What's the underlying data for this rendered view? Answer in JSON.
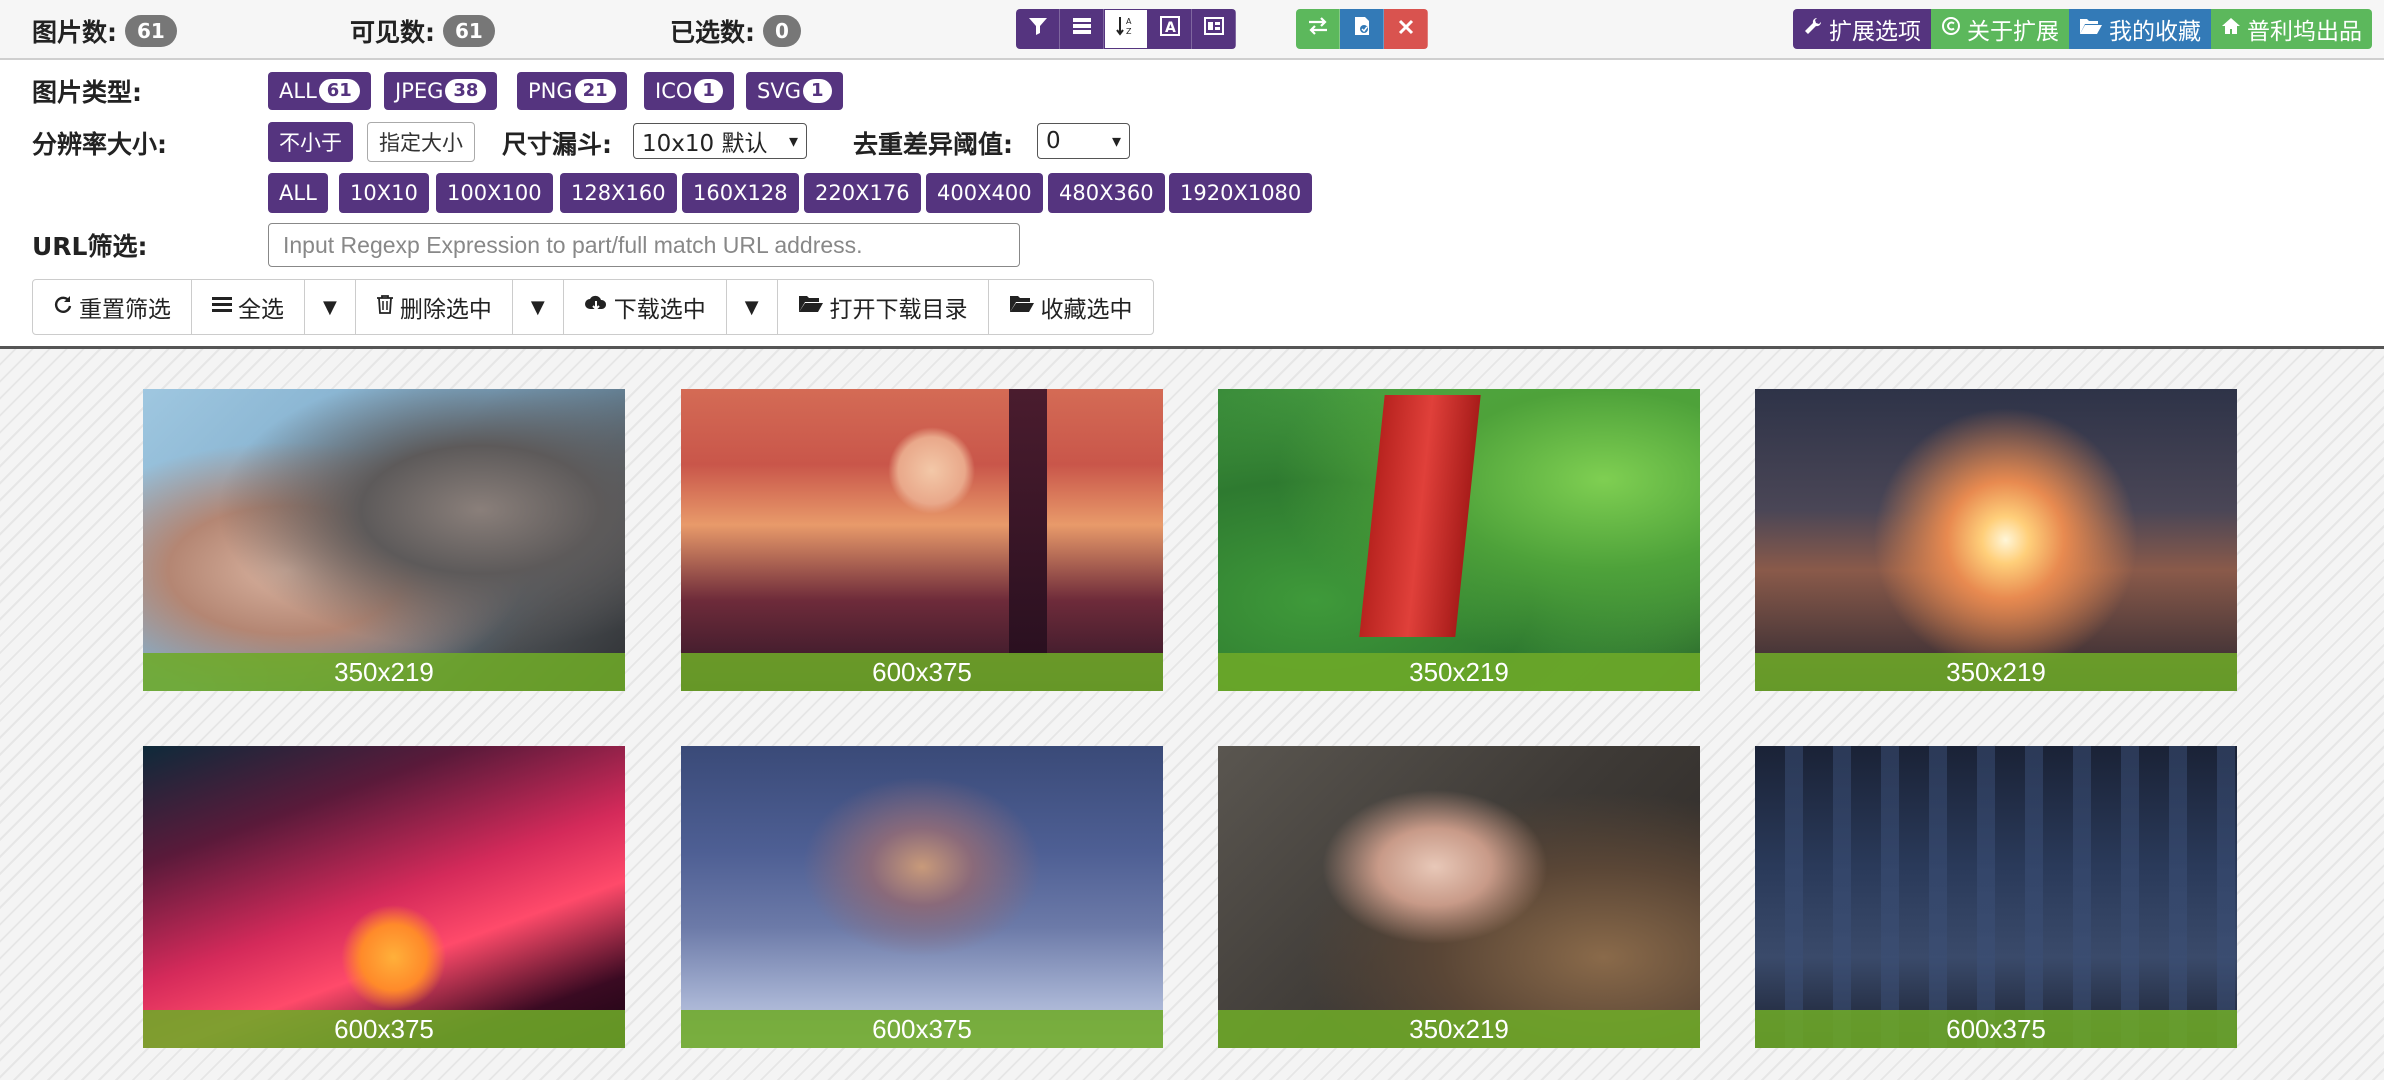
{
  "stats": {
    "total_label": "图片数:",
    "total": "61",
    "visible_label": "可见数:",
    "visible": "61",
    "selected_label": "已选数:",
    "selected": "0"
  },
  "toolbar_icons": [
    "filter-icon",
    "list-icon",
    "sort-icon",
    "font-icon",
    "layout-icon"
  ],
  "action_icons": [
    "swap-icon",
    "file-icon",
    "close-icon"
  ],
  "right_buttons": {
    "options": "扩展选项",
    "about": "关于扩展",
    "favorites": "我的收藏",
    "product": "普利坞出品"
  },
  "filters": {
    "type_label": "图片类型:",
    "types": [
      {
        "label": "ALL",
        "count": "61"
      },
      {
        "label": "JPEG",
        "count": "38"
      },
      {
        "label": "PNG",
        "count": "21"
      },
      {
        "label": "ICO",
        "count": "1"
      },
      {
        "label": "SVG",
        "count": "1"
      }
    ],
    "resolution_label": "分辨率大小:",
    "not_smaller": "不小于",
    "specify_size": "指定大小",
    "funnel_label": "尺寸漏斗:",
    "funnel_value": "10x10 默认",
    "dedupe_label": "去重差异阈值:",
    "dedupe_value": "0",
    "sizes": [
      "ALL",
      "10X10",
      "100X100",
      "128X160",
      "160X128",
      "220X176",
      "400X400",
      "480X360",
      "1920X1080"
    ],
    "url_label": "URL筛选:",
    "url_placeholder": "Input Regexp Expression to part/full match URL address."
  },
  "actions": {
    "reset": "重置筛选",
    "select_all": "全选",
    "delete_selected": "删除选中",
    "download_selected": "下载选中",
    "open_download_dir": "打开下载目录",
    "favorite_selected": "收藏选中"
  },
  "images": [
    {
      "size": "350x219"
    },
    {
      "size": "600x375"
    },
    {
      "size": "350x219"
    },
    {
      "size": "350x219"
    },
    {
      "size": "600x375"
    },
    {
      "size": "600x375"
    },
    {
      "size": "350x219"
    },
    {
      "size": "600x375"
    }
  ],
  "colors": {
    "primary": "#55347f",
    "success": "#5cb85c",
    "info": "#337ab7",
    "danger": "#d9534f",
    "caption": "#6eaa28"
  }
}
